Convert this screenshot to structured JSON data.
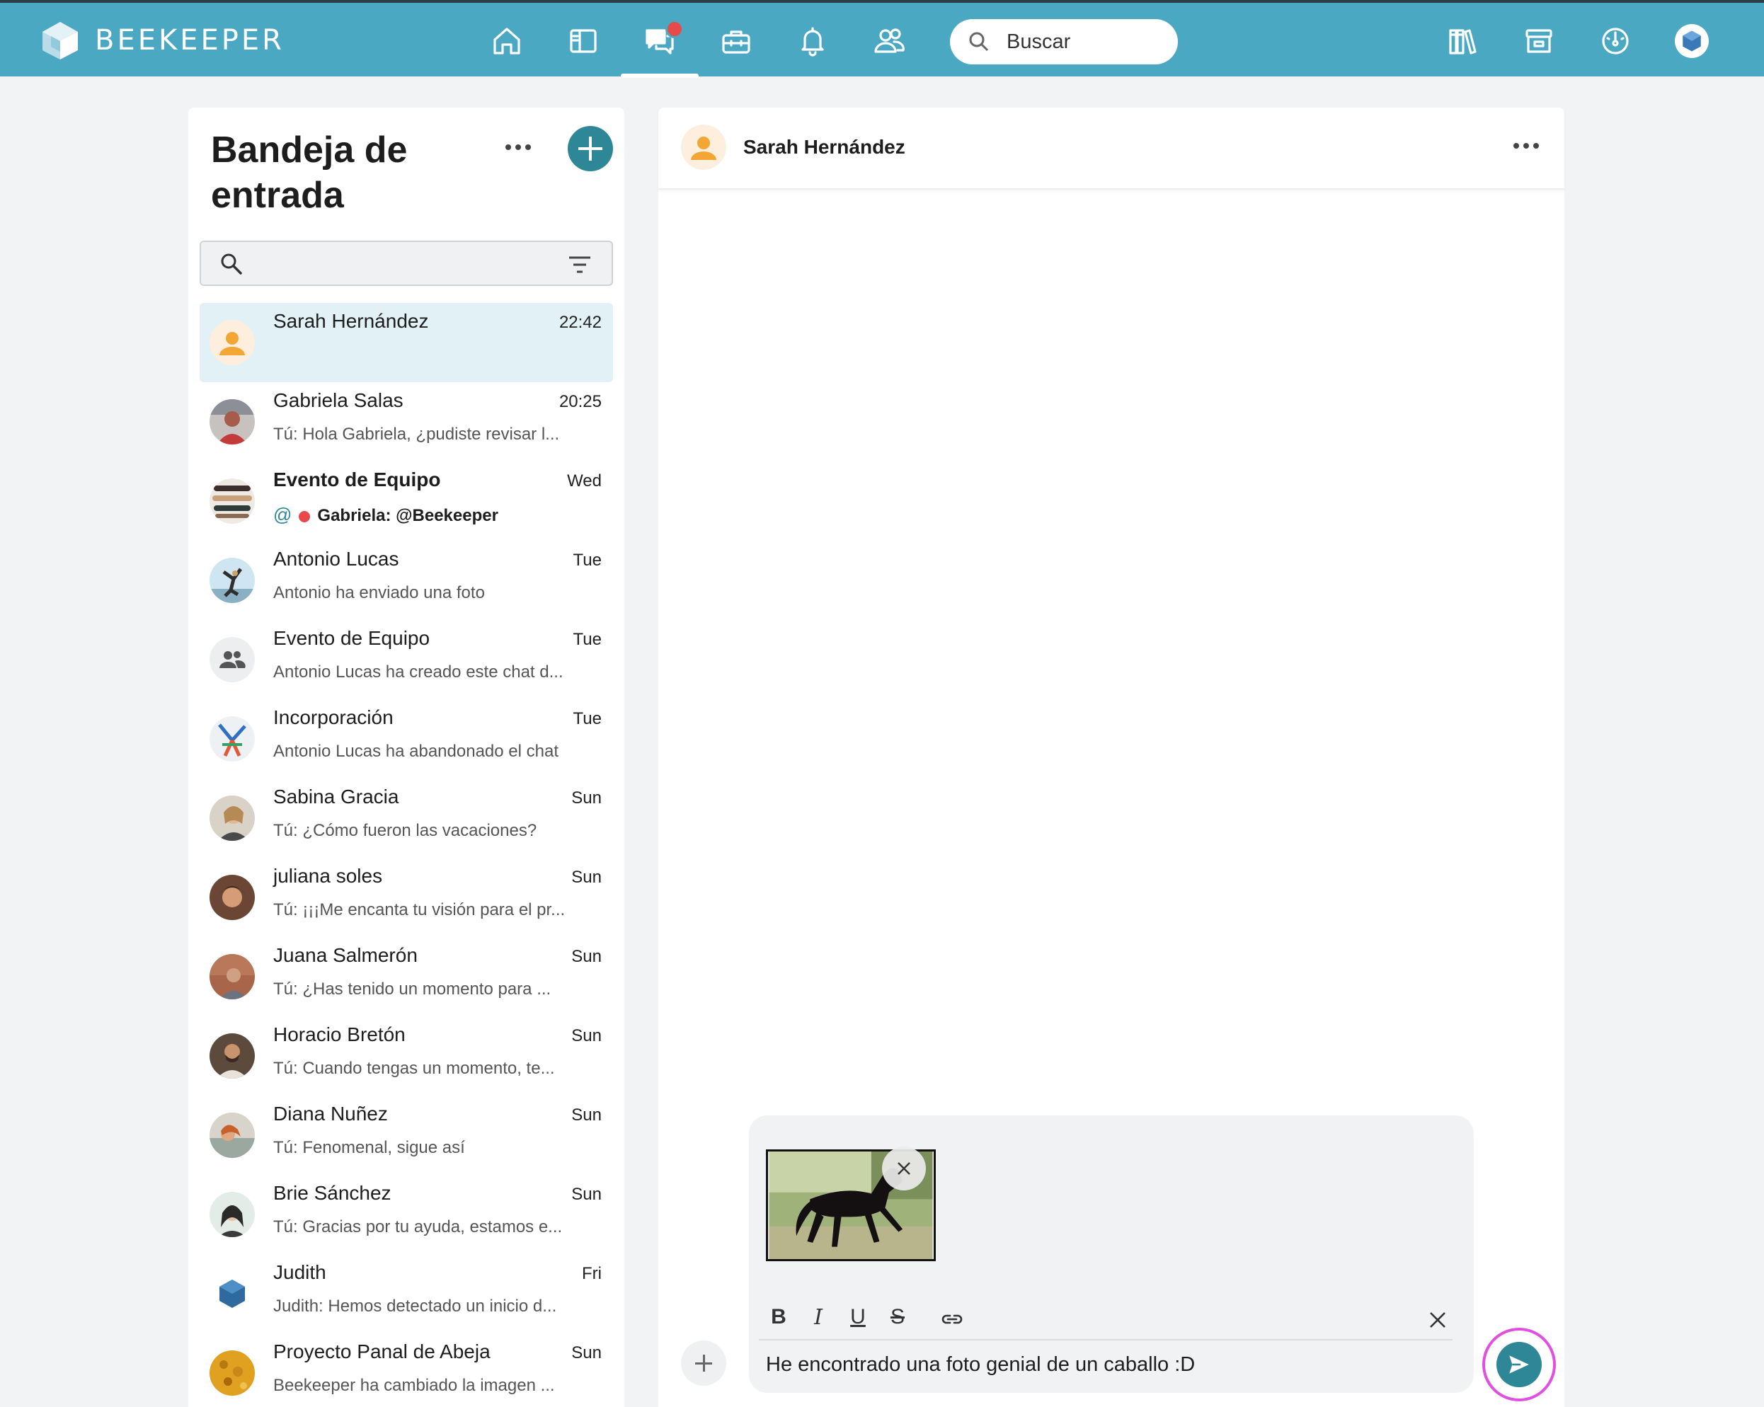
{
  "app": {
    "brand": "BEEKEEPER"
  },
  "topbar": {
    "search_placeholder": "Buscar",
    "nav_icons": [
      "home-icon",
      "news-feed-icon",
      "chats-icon",
      "tools-icon",
      "notifications-icon",
      "people-icon"
    ],
    "right_icons": [
      "library-icon",
      "store-icon",
      "dashboard-icon",
      "profile-avatar"
    ],
    "accent_color": "#4aa8c2"
  },
  "inbox": {
    "title": "Bandeja de entrada",
    "conversations": [
      {
        "name": "Sarah Hernández",
        "time": "22:42",
        "preview": ""
      },
      {
        "name": "Gabriela Salas",
        "time": "20:25",
        "preview": "Tú: Hola Gabriela, ¿pudiste revisar l..."
      },
      {
        "name": "Evento de Equipo",
        "time": "Wed",
        "preview": "Gabriela: @Beekeeper",
        "mention": "@"
      },
      {
        "name": "Antonio Lucas",
        "time": "Tue",
        "preview": "Antonio ha enviado una foto"
      },
      {
        "name": "Evento de Equipo",
        "time": "Tue",
        "preview": "Antonio Lucas ha creado este chat d..."
      },
      {
        "name": "Incorporación",
        "time": "Tue",
        "preview": "Antonio Lucas ha abandonado el chat"
      },
      {
        "name": "Sabina Gracia",
        "time": "Sun",
        "preview": "Tú: ¿Cómo fueron las vacaciones?"
      },
      {
        "name": "juliana soles",
        "time": "Sun",
        "preview": "Tú: ¡¡¡Me encanta tu visión para el pr..."
      },
      {
        "name": "Juana Salmerón",
        "time": "Sun",
        "preview": "Tú: ¿Has tenido un momento para ..."
      },
      {
        "name": "Horacio Bretón",
        "time": "Sun",
        "preview": "Tú: Cuando tengas un momento, te..."
      },
      {
        "name": "Diana Nuñez",
        "time": "Sun",
        "preview": "Tú: Fenomenal, sigue así"
      },
      {
        "name": "Brie Sánchez",
        "time": "Sun",
        "preview": "Tú: Gracias por tu ayuda, estamos e..."
      },
      {
        "name": "Judith",
        "time": "Fri",
        "preview": "Judith: Hemos detectado un inicio d..."
      },
      {
        "name": "Proyecto Panal de Abeja",
        "time": "Sun",
        "preview": "Beekeeper ha cambiado la imagen ..."
      }
    ]
  },
  "chat": {
    "contact_name": "Sarah Hernández",
    "composer_text": "He encontrado una foto genial de un caballo :D",
    "format_buttons": [
      "B",
      "I",
      "U",
      "S",
      "link"
    ]
  }
}
